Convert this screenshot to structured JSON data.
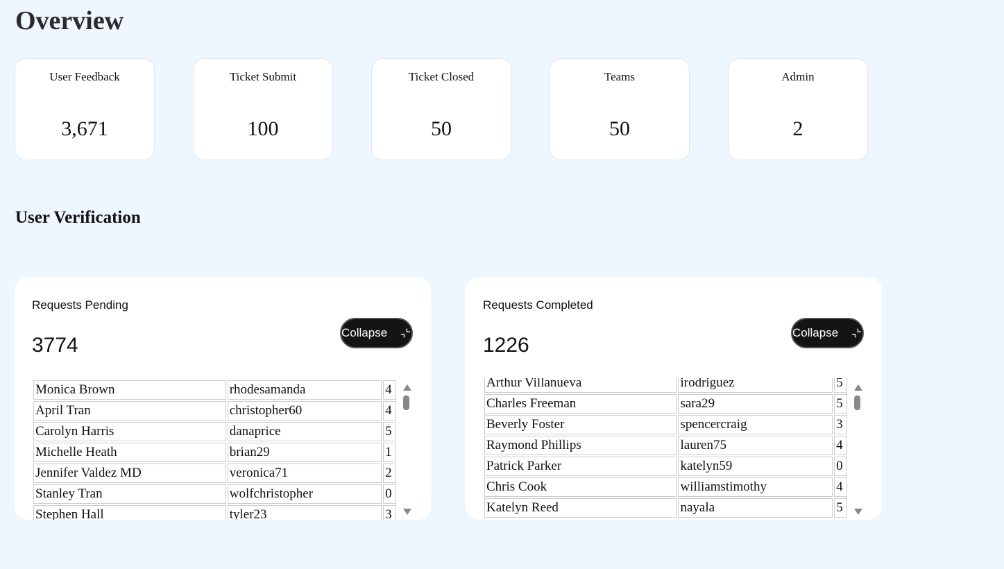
{
  "page": {
    "title": "Overview"
  },
  "stats": [
    {
      "label": "User Feedback",
      "value": "3,671"
    },
    {
      "label": "Ticket Submit",
      "value": "100"
    },
    {
      "label": "Ticket Closed",
      "value": "50"
    },
    {
      "label": "Teams",
      "value": "50"
    },
    {
      "label": "Admin",
      "value": "2"
    }
  ],
  "verification": {
    "title": "User Verification",
    "pending": {
      "title": "Requests Pending",
      "count": "3774",
      "collapse_label": "Collapse",
      "rows": [
        [
          "Monica Brown",
          "rhodesamanda",
          "4"
        ],
        [
          "April Tran",
          "christopher60",
          "4"
        ],
        [
          "Carolyn Harris",
          "danaprice",
          "5"
        ],
        [
          "Michelle Heath",
          "brian29",
          "1"
        ],
        [
          "Jennifer Valdez MD",
          "veronica71",
          "2"
        ],
        [
          "Stanley Tran",
          "wolfchristopher",
          "0"
        ],
        [
          "Stephen Hall",
          "tyler23",
          "3"
        ]
      ]
    },
    "completed": {
      "title": "Requests Completed",
      "count": "1226",
      "collapse_label": "Collapse",
      "rows": [
        [
          "Arthur Villanueva",
          "irodriguez",
          "5"
        ],
        [
          "Charles Freeman",
          "sara29",
          "5"
        ],
        [
          "Beverly Foster",
          "spencercraig",
          "3"
        ],
        [
          "Raymond Phillips",
          "lauren75",
          "4"
        ],
        [
          "Patrick Parker",
          "katelyn59",
          "0"
        ],
        [
          "Chris Cook",
          "williamstimothy",
          "4"
        ],
        [
          "Katelyn Reed",
          "nayala",
          "5"
        ]
      ]
    }
  },
  "icons": {
    "collapse": "collapse-icon",
    "scroll_up": "scroll-up-arrow-icon",
    "scroll_down": "scroll-down-arrow-icon"
  },
  "colors": {
    "background": "#eef6ff",
    "card": "#ffffff",
    "button": "#141414"
  }
}
